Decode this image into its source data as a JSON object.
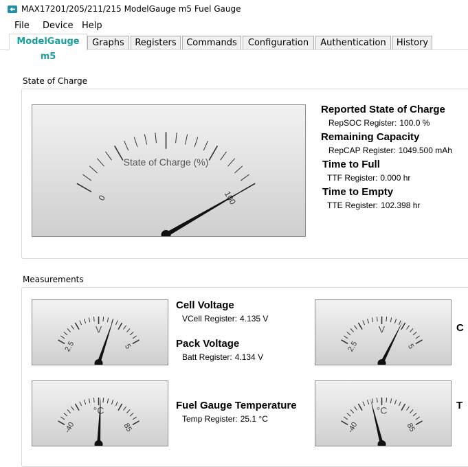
{
  "window": {
    "title": "MAX17201/205/211/215 ModelGauge m5 Fuel Gauge"
  },
  "menu": {
    "file": "File",
    "device": "Device",
    "help": "Help"
  },
  "tabs": [
    "ModelGauge m5",
    "Graphs",
    "Registers",
    "Commands",
    "Configuration",
    "Authentication",
    "History"
  ],
  "active_tab": "ModelGauge m5",
  "soc": {
    "group_label": "State of Charge",
    "gauge": {
      "caption": "State of Charge (%)",
      "min_label": "0",
      "max_label": "100",
      "min": 0,
      "max": 100,
      "value": 100.0
    },
    "metrics": [
      {
        "title": "Reported State of Charge",
        "label": "RepSOC Register:",
        "value": "100.0 %"
      },
      {
        "title": "Remaining Capacity",
        "label": "RepCAP Register:",
        "value": "1049.500 mAh"
      },
      {
        "title": "Time to Full",
        "label": "TTF Register:",
        "value": "0.000 hr"
      },
      {
        "title": "Time to Empty",
        "label": "TTE Register:",
        "value": "102.398 hr"
      }
    ]
  },
  "measurements": {
    "group_label": "Measurements",
    "voltage_gauge": {
      "caption": "V",
      "min_label": "2.5",
      "max_label": "5",
      "min": 2.5,
      "max": 5,
      "value": 4.135
    },
    "voltage_gauge_2": {
      "caption": "V",
      "min_label": "2.5",
      "max_label": "5",
      "min": 2.5,
      "max": 5,
      "value": 4.3
    },
    "temp_gauge": {
      "caption": "°C",
      "min_label": "-40",
      "max_label": "85",
      "min": -40,
      "max": 85,
      "value": 25.1
    },
    "temp_gauge_2": {
      "caption": "°C",
      "min_label": "-40",
      "max_label": "85",
      "min": -40,
      "max": 85,
      "value": 8
    },
    "cell_voltage": {
      "title": "Cell Voltage",
      "label": "VCell Register:",
      "value": "4.135 V"
    },
    "pack_voltage": {
      "title": "Pack Voltage",
      "label": "Batt Register:",
      "value": "4.134 V"
    },
    "temperature": {
      "title": "Fuel Gauge Temperature",
      "label": "Temp Register:",
      "value": "25.1 °C"
    },
    "cut_title_1": "C",
    "cut_title_2": "T"
  },
  "colors": {
    "accent": "#1a9fa0",
    "needle": "#111111",
    "gauge_border": "#8c8c8c"
  }
}
